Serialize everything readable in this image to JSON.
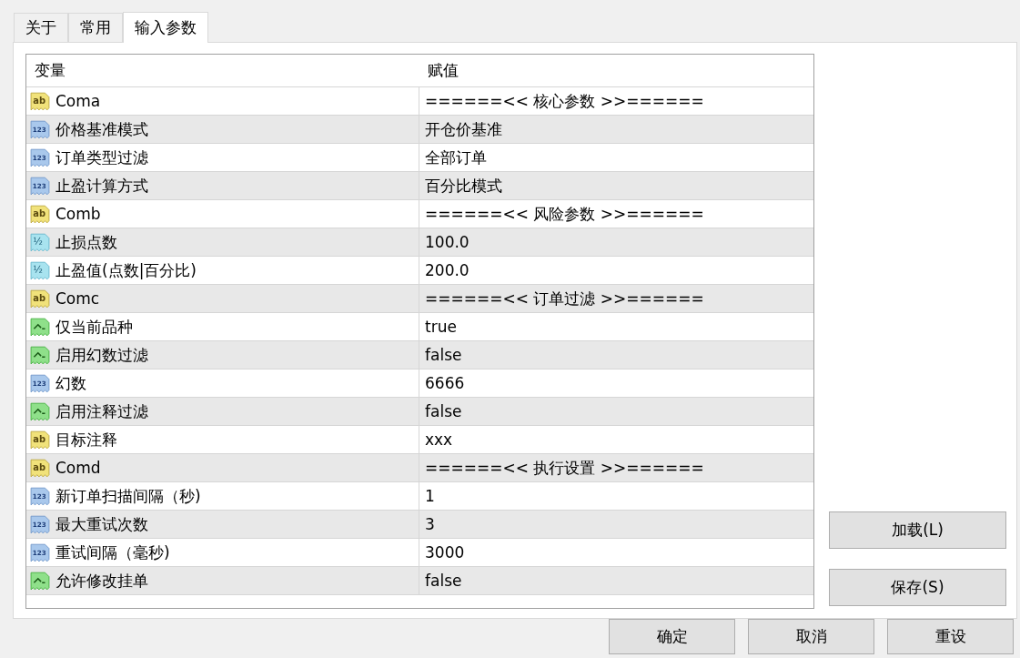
{
  "tabs": [
    {
      "label": "关于",
      "selected": false
    },
    {
      "label": "常用",
      "selected": false
    },
    {
      "label": "输入参数",
      "selected": true
    }
  ],
  "table": {
    "columns": [
      "变量",
      "赋值"
    ],
    "rows": [
      {
        "kind": "string",
        "icon_label": "ab",
        "variable": "Coma",
        "value": "======<< 核心参数 >>======"
      },
      {
        "kind": "integer",
        "icon_label": "123",
        "variable": "价格基准模式",
        "value": "开仓价基准"
      },
      {
        "kind": "integer",
        "icon_label": "123",
        "variable": "订单类型过滤",
        "value": "全部订单"
      },
      {
        "kind": "integer",
        "icon_label": "123",
        "variable": "止盈计算方式",
        "value": "百分比模式"
      },
      {
        "kind": "string",
        "icon_label": "ab",
        "variable": "Comb",
        "value": "======<< 风险参数 >>======"
      },
      {
        "kind": "double",
        "icon_label": "½",
        "variable": "止损点数",
        "value": "100.0"
      },
      {
        "kind": "double",
        "icon_label": "½",
        "variable": "止盈值(点数|百分比)",
        "value": "200.0"
      },
      {
        "kind": "string",
        "icon_label": "ab",
        "variable": "Comc",
        "value": "======<< 订单过滤 >>======"
      },
      {
        "kind": "bool",
        "variable": "仅当前品种",
        "value": "true"
      },
      {
        "kind": "bool",
        "variable": "启用幻数过滤",
        "value": "false"
      },
      {
        "kind": "integer",
        "icon_label": "123",
        "variable": "幻数",
        "value": "6666"
      },
      {
        "kind": "bool",
        "variable": "启用注释过滤",
        "value": "false"
      },
      {
        "kind": "string",
        "icon_label": "ab",
        "variable": "目标注释",
        "value": "xxx"
      },
      {
        "kind": "string",
        "icon_label": "ab",
        "variable": "Comd",
        "value": "======<< 执行设置 >>======"
      },
      {
        "kind": "integer",
        "icon_label": "123",
        "variable": "新订单扫描间隔（秒)",
        "value": "1"
      },
      {
        "kind": "integer",
        "icon_label": "123",
        "variable": "最大重试次数",
        "value": "3"
      },
      {
        "kind": "integer",
        "icon_label": "123",
        "variable": "重试间隔（毫秒)",
        "value": "3000"
      },
      {
        "kind": "bool",
        "variable": "允许修改挂单",
        "value": "false"
      }
    ]
  },
  "side_buttons": [
    "加载(L)",
    "保存(S)"
  ],
  "buttons": [
    "确定",
    "取消",
    "重设"
  ]
}
